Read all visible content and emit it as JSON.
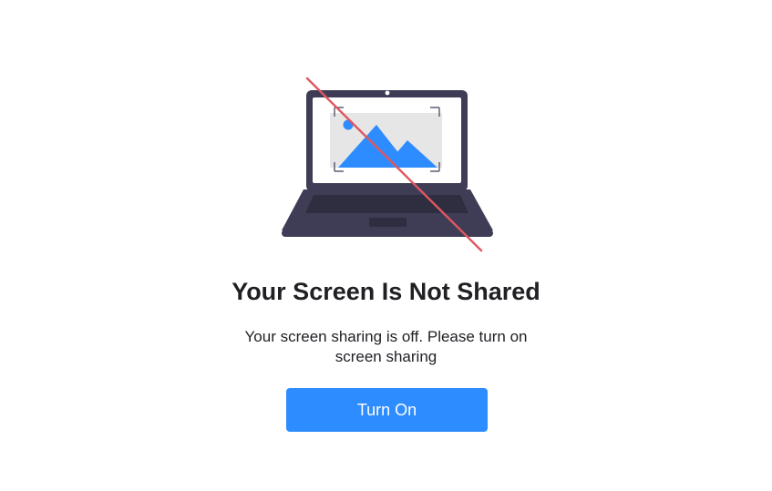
{
  "status": {
    "title": "Your Screen Is Not Shared",
    "message": "Your screen sharing is off. Please turn on screen sharing"
  },
  "actions": {
    "turn_on_label": "Turn On"
  },
  "colors": {
    "accent": "#2d8cff",
    "laptop": "#3f3d56",
    "strike": "#e0565f"
  },
  "illustration": {
    "icon": "laptop-screen-share-off-icon"
  }
}
